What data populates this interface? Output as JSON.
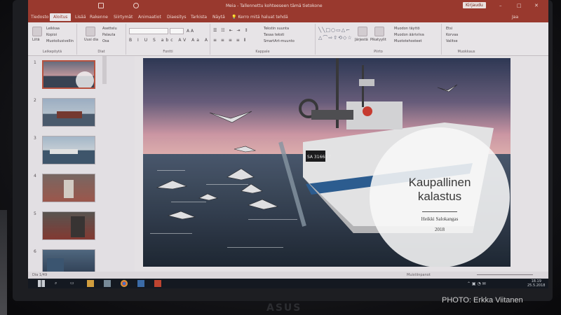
{
  "window": {
    "title": "Meia  -  Tallennettu kohteeseen tämä tietokone",
    "signin_label": "Kirjaudu",
    "controls": [
      "–",
      "□",
      "✕"
    ]
  },
  "tabs": [
    "Tiedosto",
    "Aloitus",
    "Lisää",
    "Rakenne",
    "Siirtymät",
    "Animaatiot",
    "Diaesitys",
    "Tarkista",
    "Näytä"
  ],
  "active_tab_index": 1,
  "tell_me": "Kerro mitä haluat tehdä",
  "share_label": "Jaa",
  "ribbon": {
    "groups": {
      "clipboard": "Leikepöytä",
      "slides": "Diat",
      "font": "Fontti",
      "paragraph": "Kappale",
      "drawing": "Piirto",
      "editing": "Muokkaus"
    },
    "clipboard_items": [
      "Leikkaa",
      "Kopioi",
      "Muotoilusivellin"
    ],
    "paste_label": "Liitä",
    "new_slide_label": "Uusi dia",
    "slide_items": [
      "Asettelu",
      "Palauta",
      "Osa"
    ],
    "paragraph_items": [
      "Tekstin suunta",
      "Tasaa teksti",
      "SmartArt-muunto"
    ],
    "drawing_items": [
      "Järjestä",
      "Pikatyylit"
    ],
    "shape_format_items": [
      "Muodon täyttö",
      "Muodon ääriviiva",
      "Muototehosteet"
    ],
    "editing_items": [
      "Etsi",
      "Korvaa",
      "Valitse"
    ]
  },
  "thumbnails": [
    {
      "num": "1",
      "selected": true
    },
    {
      "num": "2",
      "selected": false
    },
    {
      "num": "3",
      "selected": false
    },
    {
      "num": "4",
      "selected": false
    },
    {
      "num": "5",
      "selected": false
    },
    {
      "num": "6",
      "selected": false
    }
  ],
  "slide": {
    "title_line1": "Kaupallinen",
    "title_line2": "kalastus",
    "author": "Heikki Salokangas",
    "year": "2018",
    "hull_number": "SA 31668-T"
  },
  "status": {
    "slide_counter": "Dia 1/49",
    "notes_label": "Muistiinpanot"
  },
  "taskbar": {
    "time": "18.19",
    "date": "25.5.2018"
  },
  "monitor_brand": "ASUS",
  "photo_credit": "PHOTO: Erkka Viitanen",
  "colors": {
    "ppt_accent": "#a23a2e",
    "sky_top": "#3b4a6b",
    "sky_horizon": "#d99aa8",
    "sea": "#2c3a4c"
  }
}
